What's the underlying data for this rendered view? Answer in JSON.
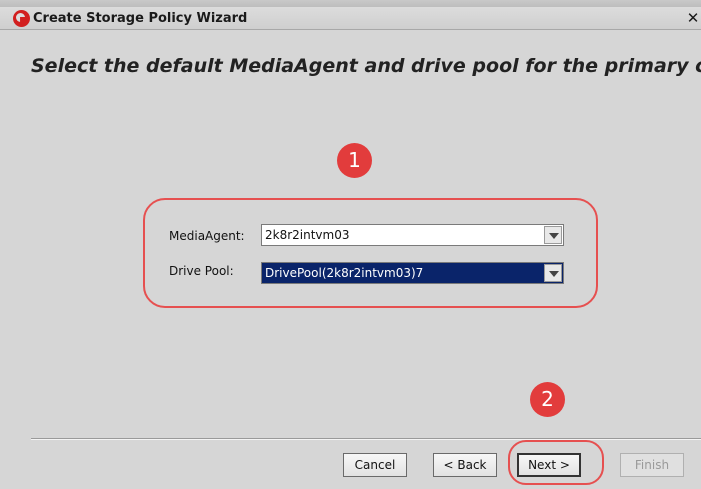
{
  "window": {
    "title": "Create Storage Policy Wizard",
    "close_symbol": "✕"
  },
  "page": {
    "heading": "Select the default MediaAgent and drive pool for the primary copy"
  },
  "annotations": {
    "step1": "1",
    "step2": "2",
    "color": "#e23c3c"
  },
  "fields": {
    "media_agent": {
      "label": "MediaAgent:",
      "value": "2k8r2intvm03"
    },
    "drive_pool": {
      "label": "Drive Pool:",
      "value": "DrivePool(2k8r2intvm03)7",
      "selected": true
    }
  },
  "buttons": {
    "cancel": "Cancel",
    "back": "< Back",
    "next": "Next >",
    "finish": "Finish",
    "finish_enabled": false
  },
  "icons": {
    "app": "app-logo-icon",
    "close": "close-icon",
    "dropdown": "chevron-down-icon"
  },
  "colors": {
    "selection": "#0a246a",
    "highlight_ring": "#e65050"
  }
}
